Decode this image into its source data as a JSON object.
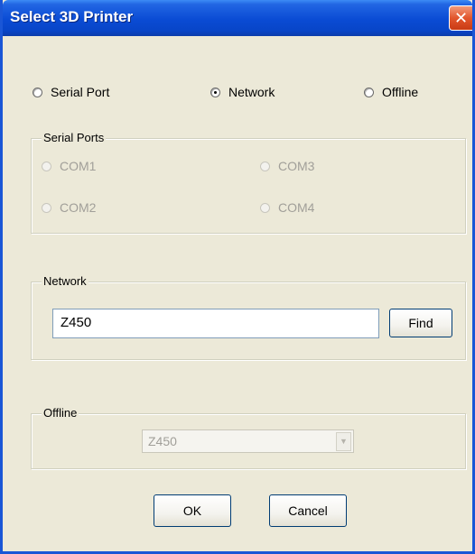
{
  "window": {
    "title": "Select 3D Printer",
    "close_icon": "close-icon",
    "close_glyph": "✕"
  },
  "mode": {
    "options": [
      {
        "label": "Serial Port",
        "checked": false
      },
      {
        "label": "Network",
        "checked": true
      },
      {
        "label": "Offline",
        "checked": false
      }
    ]
  },
  "serial": {
    "legend": "Serial Ports",
    "ports": [
      "COM1",
      "COM3",
      "COM2",
      "COM4"
    ]
  },
  "network": {
    "legend": "Network",
    "value": "Z450",
    "find_label": "Find"
  },
  "offline": {
    "legend": "Offline",
    "selected": "Z450",
    "arrow_glyph": "▼"
  },
  "buttons": {
    "ok_label": "OK",
    "cancel_label": "Cancel"
  },
  "colors": {
    "title_bar": "#0a4bd4",
    "face": "#ece9d8",
    "close": "#e2562d"
  }
}
